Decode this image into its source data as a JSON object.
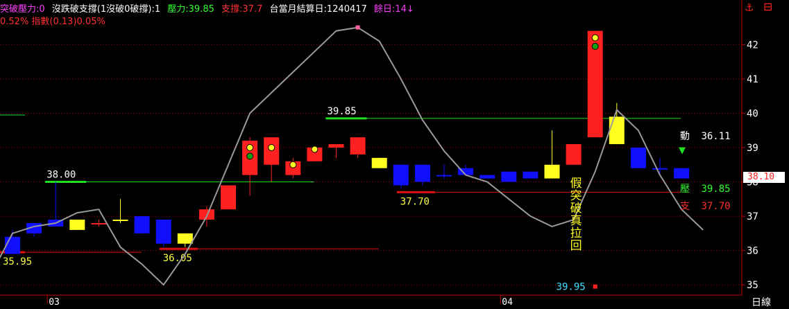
{
  "header": {
    "seg1": "突破壓力:0",
    "seg2": "沒跌破支撐(1沒破0破撐):1",
    "seg3": "壓力:39.85",
    "seg4": "支撐:37.7",
    "seg5": "台當月結算日:1240417",
    "seg6": "餘日:14↓",
    "line2": "0.52% 指數(0.13)0.05%"
  },
  "corner": {
    "anchor_icon": "⚓",
    "window_icon": "⊟"
  },
  "right_panel": {
    "dong_label": "動",
    "dong_value": "36.11",
    "ya_label": "壓",
    "ya_value": "39.85",
    "zhi_label": "支",
    "zhi_value": "37.70",
    "current_price": "38.10"
  },
  "bottom": {
    "period": "日線"
  },
  "colors": {
    "up": "#ff2020",
    "down": "#1010ff",
    "doji": "#ffff20",
    "resistance": "#20e020",
    "support": "#e01010",
    "curve": "#9a9a9a",
    "axis": "#c00000",
    "price_tag": "#ff3030"
  },
  "chart_data": {
    "type": "candlestick",
    "ylim": [
      34.7,
      43.3
    ],
    "y_ticks": [
      35,
      36,
      37,
      38,
      39,
      40,
      41,
      42
    ],
    "x_labels": [
      {
        "label": "03",
        "index": 2
      },
      {
        "label": "04",
        "index": 23
      }
    ],
    "candles": [
      {
        "o": 36.4,
        "h": 36.6,
        "l": 35.9,
        "c": 35.9,
        "color": "down"
      },
      {
        "o": 36.8,
        "h": 36.8,
        "l": 36.4,
        "c": 36.5,
        "color": "down"
      },
      {
        "o": 36.9,
        "h": 38.0,
        "l": 36.7,
        "c": 36.7,
        "color": "down"
      },
      {
        "o": 36.6,
        "h": 36.9,
        "l": 36.6,
        "c": 36.9,
        "color": "doji"
      },
      {
        "o": 36.8,
        "h": 36.9,
        "l": 36.7,
        "c": 36.8,
        "color": "up"
      },
      {
        "o": 36.9,
        "h": 37.5,
        "l": 36.8,
        "c": 36.9,
        "color": "doji"
      },
      {
        "o": 37.0,
        "h": 37.0,
        "l": 36.5,
        "c": 36.5,
        "color": "down"
      },
      {
        "o": 36.9,
        "h": 36.9,
        "l": 36.1,
        "c": 36.2,
        "color": "down"
      },
      {
        "o": 36.2,
        "h": 36.5,
        "l": 36.1,
        "c": 36.5,
        "color": "doji"
      },
      {
        "o": 36.9,
        "h": 37.3,
        "l": 36.7,
        "c": 37.2,
        "color": "up"
      },
      {
        "o": 37.2,
        "h": 37.9,
        "l": 37.2,
        "c": 37.9,
        "color": "up"
      },
      {
        "o": 38.2,
        "h": 39.3,
        "l": 37.6,
        "c": 39.2,
        "color": "up"
      },
      {
        "o": 38.5,
        "h": 39.3,
        "l": 38.0,
        "c": 39.3,
        "color": "up"
      },
      {
        "o": 38.2,
        "h": 38.7,
        "l": 38.1,
        "c": 38.6,
        "color": "up"
      },
      {
        "o": 38.6,
        "h": 39.0,
        "l": 38.6,
        "c": 39.0,
        "color": "up"
      },
      {
        "o": 39.0,
        "h": 39.1,
        "l": 38.7,
        "c": 39.1,
        "color": "up"
      },
      {
        "o": 38.8,
        "h": 39.3,
        "l": 38.7,
        "c": 39.3,
        "color": "up"
      },
      {
        "o": 38.4,
        "h": 38.7,
        "l": 38.4,
        "c": 38.7,
        "color": "doji"
      },
      {
        "o": 38.5,
        "h": 38.5,
        "l": 37.8,
        "c": 37.9,
        "color": "down"
      },
      {
        "o": 38.5,
        "h": 38.5,
        "l": 37.9,
        "c": 38.0,
        "color": "down"
      },
      {
        "o": 38.2,
        "h": 38.5,
        "l": 38.1,
        "c": 38.2,
        "color": "down"
      },
      {
        "o": 38.4,
        "h": 38.5,
        "l": 38.2,
        "c": 38.2,
        "color": "down"
      },
      {
        "o": 38.2,
        "h": 38.2,
        "l": 38.1,
        "c": 38.1,
        "color": "down"
      },
      {
        "o": 38.3,
        "h": 38.3,
        "l": 38.0,
        "c": 38.0,
        "color": "down"
      },
      {
        "o": 38.3,
        "h": 38.3,
        "l": 38.1,
        "c": 38.1,
        "color": "down"
      },
      {
        "o": 38.1,
        "h": 39.5,
        "l": 38.1,
        "c": 38.5,
        "color": "doji"
      },
      {
        "o": 38.5,
        "h": 39.1,
        "l": 38.5,
        "c": 39.1,
        "color": "up"
      },
      {
        "o": 39.3,
        "h": 42.4,
        "l": 39.3,
        "c": 42.4,
        "color": "up"
      },
      {
        "o": 39.9,
        "h": 40.3,
        "l": 39.1,
        "c": 39.1,
        "color": "doji"
      },
      {
        "o": 39.0,
        "h": 39.0,
        "l": 38.4,
        "c": 38.4,
        "color": "down"
      },
      {
        "o": 38.4,
        "h": 38.7,
        "l": 38.2,
        "c": 38.4,
        "color": "down"
      },
      {
        "o": 38.4,
        "h": 38.4,
        "l": 38.1,
        "c": 38.1,
        "color": "down"
      }
    ],
    "curve": [
      35.3,
      36.5,
      36.7,
      36.8,
      37.1,
      37.2,
      36.1,
      35.6,
      35.0,
      35.9,
      37.0,
      38.5,
      40.0,
      40.6,
      41.2,
      41.8,
      42.4,
      42.5,
      42.1,
      41.0,
      39.8,
      38.9,
      38.2,
      38.0,
      37.5,
      37.0,
      36.7,
      36.9,
      38.3,
      40.1,
      39.5,
      38.2,
      37.2,
      36.6
    ],
    "resistance_lines": [
      {
        "label": "38.00",
        "value": 38.0,
        "from": 2,
        "to": 14
      },
      {
        "label": "39.85",
        "value": 39.85,
        "from": 15,
        "to": 31
      }
    ],
    "support_lines": [
      {
        "label": "35.95",
        "value": 35.95,
        "from": -1,
        "to": 6
      },
      {
        "label": "36.05",
        "value": 36.05,
        "from": 7,
        "to": 17
      },
      {
        "label": "37.70",
        "value": 37.7,
        "from": 18,
        "to": 31
      }
    ],
    "dots": [
      {
        "index": 11,
        "value": 39.0,
        "kind": "yellow"
      },
      {
        "index": 11,
        "value": 38.75,
        "kind": "green"
      },
      {
        "index": 12,
        "value": 39.0,
        "kind": "yellow"
      },
      {
        "index": 13,
        "value": 38.5,
        "kind": "yellow"
      },
      {
        "index": 14,
        "value": 38.95,
        "kind": "yellow"
      },
      {
        "index": 27,
        "value": 42.2,
        "kind": "yellow"
      },
      {
        "index": 27,
        "value": 41.95,
        "kind": "green"
      }
    ],
    "markers": [
      {
        "label": "39.95",
        "index": 27,
        "value": 34.95
      }
    ],
    "annotation": "假突破真拉回"
  }
}
